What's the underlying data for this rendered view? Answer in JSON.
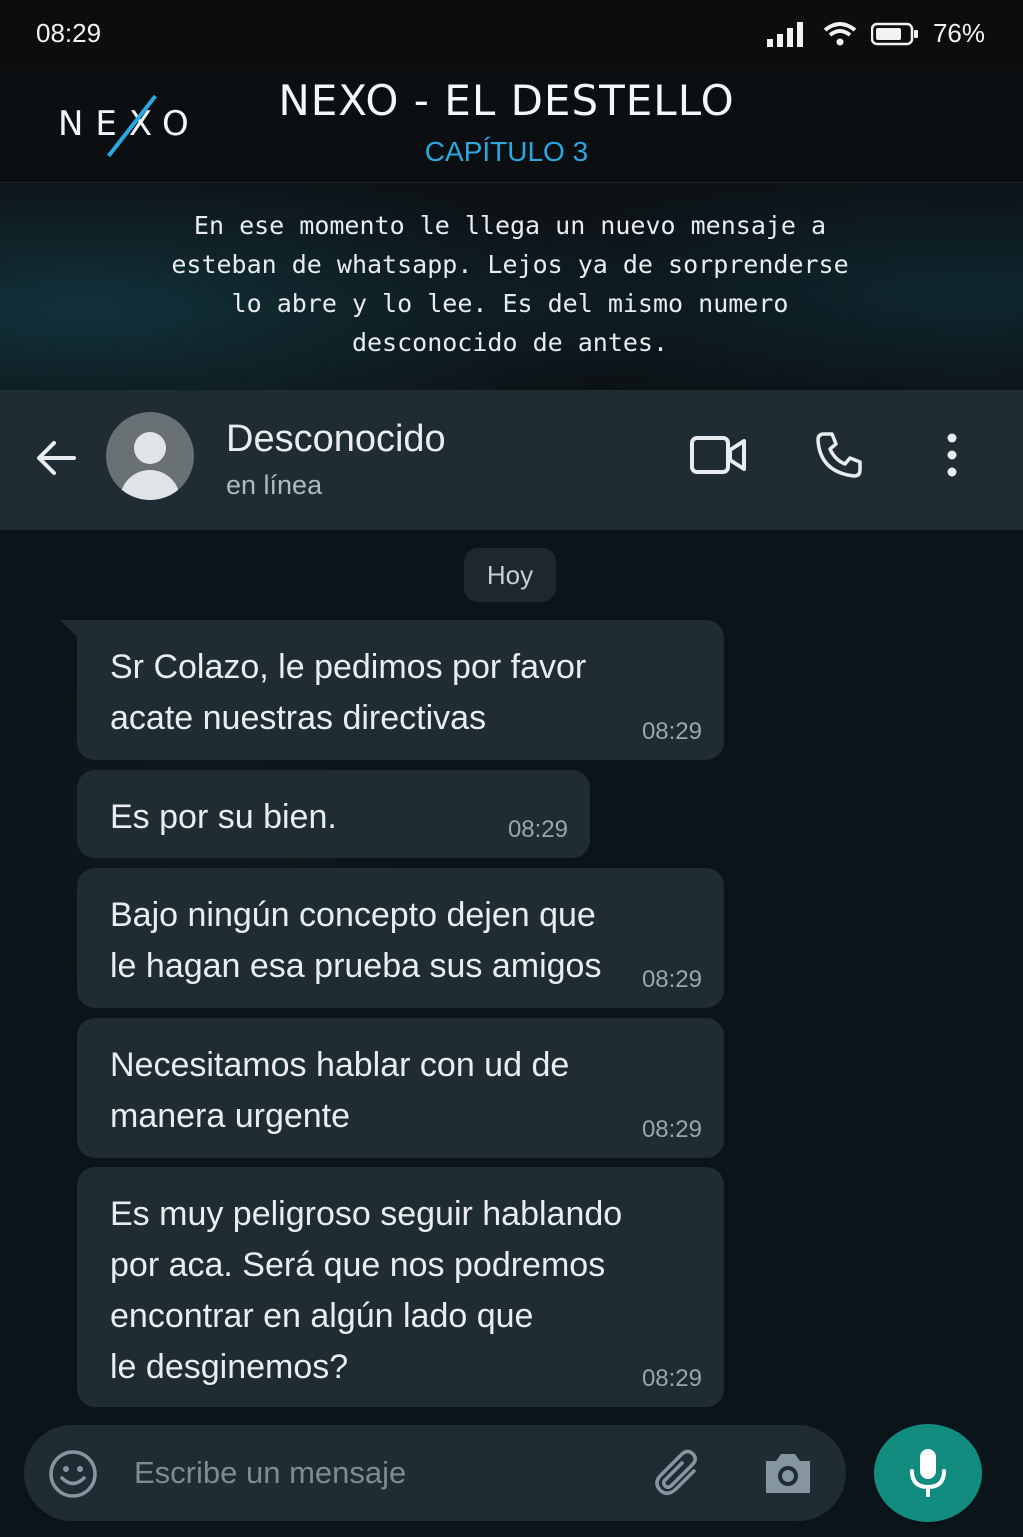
{
  "status_bar": {
    "time": "08:29",
    "battery": "76%"
  },
  "banner": {
    "logo": "NEXO",
    "title": "NEXO - EL DESTELLO",
    "chapter": "CAPÍTULO 3",
    "narration": "En ese momento le llega un nuevo mensaje a\nesteban de whatsapp. Lejos ya de sorprenderse\nlo abre y lo lee. Es del mismo numero\ndesconocido de antes."
  },
  "chat_header": {
    "name": "Desconocido",
    "status": "en línea"
  },
  "day_label": "Hoy",
  "messages": [
    {
      "text": "Sr Colazo, le pedimos por favor\nacate nuestras directivas",
      "time": "08:29"
    },
    {
      "text": "Es por su bien.",
      "time": "08:29"
    },
    {
      "text": "Bajo ningún concepto dejen que\nle hagan esa prueba sus amigos",
      "time": "08:29"
    },
    {
      "text": "Necesitamos hablar con ud de\nmanera urgente",
      "time": "08:29"
    },
    {
      "text": "Es muy peligroso seguir hablando\npor aca. Será que nos podremos\nencontrar en algún lado que\nle desginemos?",
      "time": "08:29"
    }
  ],
  "input": {
    "placeholder": "Escribe un mensaje"
  },
  "colors": {
    "accent": "#2ea6e0",
    "bubble": "#1f2c33",
    "mic": "#128c7e"
  }
}
